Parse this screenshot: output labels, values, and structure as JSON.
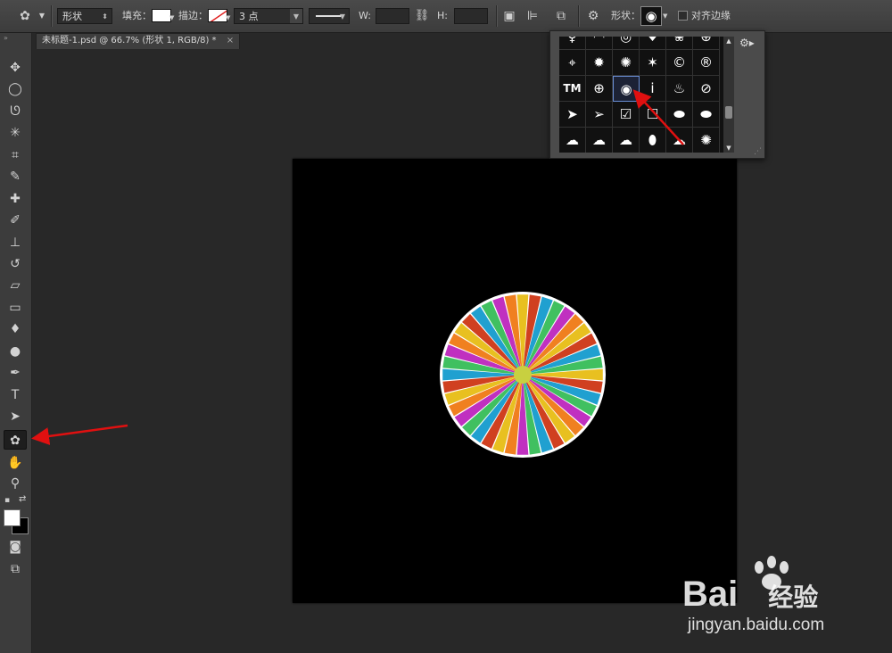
{
  "options_bar": {
    "tool_icon": "custom-shape-tool-icon",
    "mode": "形状",
    "fill_label": "填充：",
    "stroke_label": "描边：",
    "stroke_width": "3 点",
    "width_label": "W:",
    "height_label": "H:",
    "shape_label": "形状：",
    "align_edges_label": "对齐边缘",
    "align_edges_checked": false
  },
  "document": {
    "tab_title": "未标题-1.psd @ 66.7% (形状 1, RGB/8) *",
    "close_glyph": "×",
    "canvas_color": "#000000"
  },
  "toolbar": {
    "tools": [
      {
        "name": "move-tool",
        "glyph": "✥"
      },
      {
        "name": "elliptical-marquee-tool",
        "glyph": "◯"
      },
      {
        "name": "lasso-tool",
        "glyph": "ᘎ"
      },
      {
        "name": "magic-wand-tool",
        "glyph": "✳"
      },
      {
        "name": "crop-tool",
        "glyph": "⌗"
      },
      {
        "name": "eyedropper-tool",
        "glyph": "✎"
      },
      {
        "name": "healing-brush-tool",
        "glyph": "✚"
      },
      {
        "name": "brush-tool",
        "glyph": "✐"
      },
      {
        "name": "clone-stamp-tool",
        "glyph": "⊥"
      },
      {
        "name": "history-brush-tool",
        "glyph": "↺"
      },
      {
        "name": "eraser-tool",
        "glyph": "▱"
      },
      {
        "name": "gradient-tool",
        "glyph": "▭"
      },
      {
        "name": "blur-tool",
        "glyph": "♦"
      },
      {
        "name": "dodge-tool",
        "glyph": "●"
      },
      {
        "name": "pen-tool",
        "glyph": "✒"
      },
      {
        "name": "type-tool",
        "glyph": "T"
      },
      {
        "name": "path-selection-tool",
        "glyph": "➤"
      },
      {
        "name": "custom-shape-tool",
        "glyph": "✿",
        "active": true
      },
      {
        "name": "hand-tool",
        "glyph": "✋"
      },
      {
        "name": "zoom-tool",
        "glyph": "⚲"
      }
    ]
  },
  "shape_picker": {
    "rows": [
      [
        "♀",
        "◠",
        "◎",
        "♥",
        "❀",
        "⊕"
      ],
      [
        "⌖",
        "✹",
        "✺",
        "✶",
        "©",
        "®"
      ],
      [
        "TM",
        "⊕",
        "◉",
        "i",
        "♨",
        "⊘"
      ],
      [
        "➤",
        "➢",
        "☑",
        "☐",
        "⬬",
        "⬬"
      ],
      [
        "☁",
        "☁",
        "☁",
        "⬮",
        "☁",
        "✺"
      ]
    ],
    "selected": "◉"
  },
  "watermark": {
    "logo": "Bai",
    "logo_suffix": "经验",
    "url": "jingyan.baidu.com"
  },
  "colors": {
    "annotation_arrow": "#e01010",
    "picker_selection": "#6a8fd6"
  }
}
